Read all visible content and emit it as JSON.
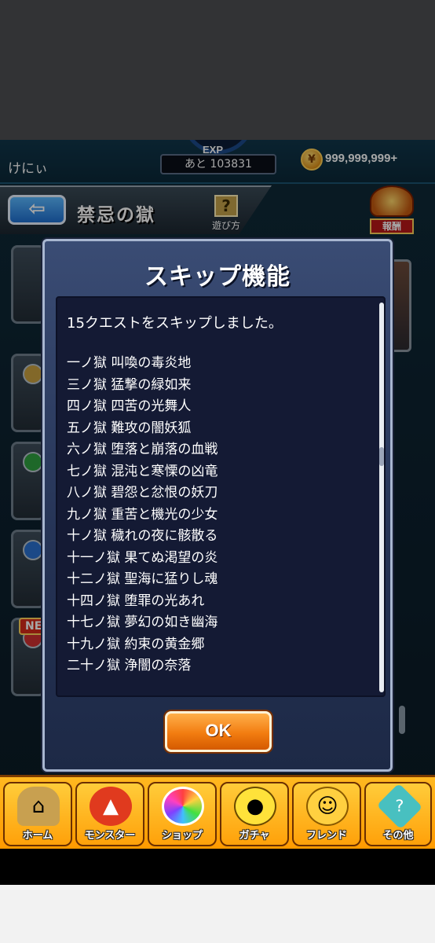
{
  "topbar": {
    "player_name": "けにぃ",
    "exp_label": "EXP",
    "exp_remaining": "あと 103831",
    "coin_icon": "coin-icon",
    "coin_value": "999,999,999+"
  },
  "header": {
    "title": "禁忌の獄",
    "help_label": "遊び方",
    "help_glyph": "?",
    "reward_label": "報酬"
  },
  "background_list": {
    "new_badge": "NEW"
  },
  "modal": {
    "title": "スキップ機能",
    "message": "15クエストをスキップしました。",
    "quests": [
      "一ノ獄 叫喚の毒炎地",
      "三ノ獄 猛撃の緑如来",
      "四ノ獄 四苦の光舞人",
      "五ノ獄 難攻の闇妖狐",
      "六ノ獄 堕落と崩落の血戦",
      "七ノ獄 混沌と寒慄の凶竜",
      "八ノ獄 碧怨と忿恨の妖刀",
      "九ノ獄 重苦と機光の少女",
      "十ノ獄 穢れの夜に骸散る",
      "十一ノ獄 果てぬ渇望の炎",
      "十二ノ獄 聖海に猛りし魂",
      "十四ノ獄 堕罪の光あれ",
      "十七ノ獄 夢幻の如き幽海",
      "十九ノ獄 約束の黄金郷",
      "二十ノ獄 浄闇の奈落"
    ],
    "ok_label": "OK"
  },
  "nav": [
    {
      "label": "ホーム",
      "icon": "home-icon",
      "color": "#c8a050"
    },
    {
      "label": "モンスター",
      "icon": "monster-icon",
      "color": "#e03a1e"
    },
    {
      "label": "ショップ",
      "icon": "rainbow-orb-icon",
      "color": "#ffffff"
    },
    {
      "label": "ガチャ",
      "icon": "gacha-egg-icon",
      "color": "#ffe23a"
    },
    {
      "label": "フレンド",
      "icon": "friends-icon",
      "color": "#ffd040"
    },
    {
      "label": "その他",
      "icon": "other-icon",
      "color": "#48c0c0"
    }
  ]
}
